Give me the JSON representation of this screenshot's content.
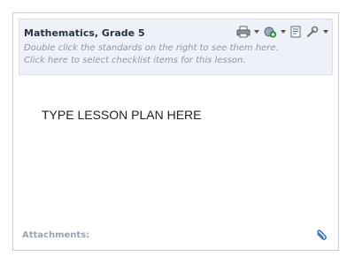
{
  "header": {
    "title": "Mathematics, Grade 5",
    "hint_line1": "Double click the standards on the right to see them here.",
    "hint_line2": "Click here to select checklist items for this lesson."
  },
  "toolbar": {
    "icons": [
      "printer-icon",
      "add-standard-icon",
      "document-icon",
      "wrench-icon"
    ]
  },
  "editor": {
    "content": "TYPE LESSON PLAN HERE"
  },
  "footer": {
    "attachments_label": "Attachments:"
  }
}
